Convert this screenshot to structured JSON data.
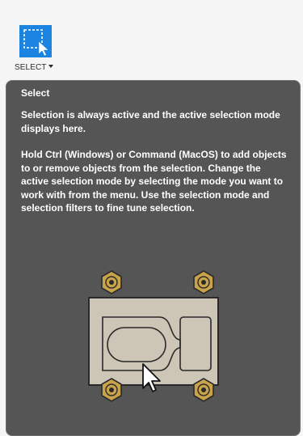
{
  "toolbar": {
    "select_label": "SELECT",
    "select_icon": "selection-box-cursor-icon",
    "accent_color": "#1a84e0"
  },
  "tooltip": {
    "title": "Select",
    "paragraph_1": "Selection is always active and the active selection mode displays here.",
    "paragraph_2": "Hold Ctrl (Windows) or Command (MacOS) to add objects to or remove objects from the selection. Change the active selection mode by selecting the mode you want to work with from the menu. Use the selection mode and selection filters to fine tune selection.",
    "illustration": "plate-with-bolts-and-cursor-illustration",
    "background_color": "#555555"
  }
}
